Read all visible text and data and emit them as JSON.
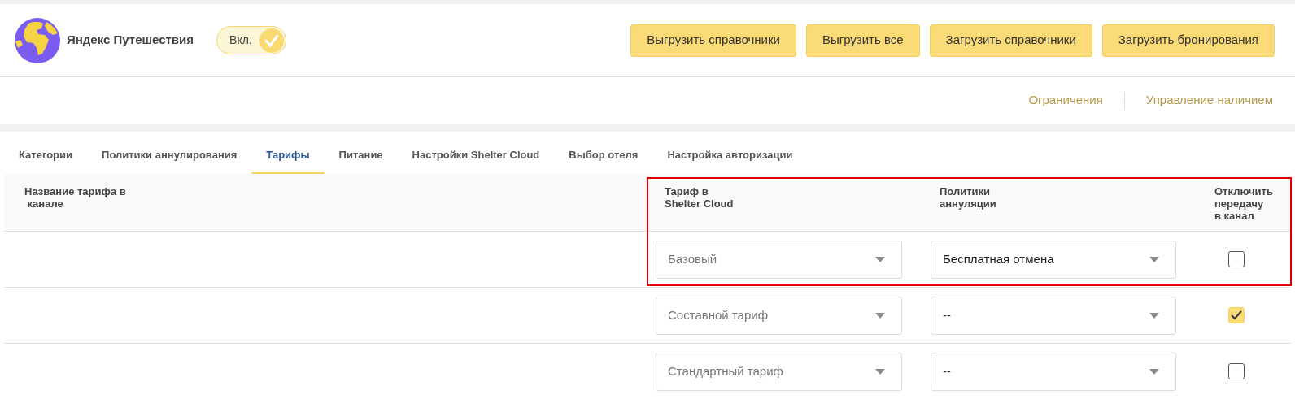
{
  "header": {
    "title": "Яндекс Путешествия",
    "toggle": {
      "label": "Вкл.",
      "on": true
    },
    "buttons": [
      "Выгрузить справочники",
      "Выгрузить все",
      "Загрузить справочники",
      "Загрузить бронирования"
    ]
  },
  "links": [
    "Ограничения",
    "Управление наличием"
  ],
  "tabs": [
    {
      "label": "Категории",
      "selected": false
    },
    {
      "label": "Политики аннулирования",
      "selected": false
    },
    {
      "label": "Тарифы",
      "selected": true
    },
    {
      "label": "Питание",
      "selected": false
    },
    {
      "label": "Настройки Shelter Cloud",
      "selected": false
    },
    {
      "label": "Выбор отеля",
      "selected": false
    },
    {
      "label": "Настройка авторизации",
      "selected": false
    }
  ],
  "table": {
    "columns": [
      "Название тарифа в\n канале",
      "Тариф в\nShelter Cloud",
      "Политики\nаннуляции",
      "Отключить\nпередачу\nв канал"
    ],
    "rows": [
      {
        "tariff": "Базовый",
        "policy": "Бесплатная отмена",
        "policy_chosen": true,
        "disabled_transfer": false,
        "highlighted": true
      },
      {
        "tariff": "Составной тариф",
        "policy": "--",
        "policy_chosen": false,
        "disabled_transfer": true,
        "highlighted": false
      },
      {
        "tariff": "Стандартный тариф",
        "policy": "--",
        "policy_chosen": false,
        "disabled_transfer": false,
        "highlighted": false
      }
    ]
  }
}
